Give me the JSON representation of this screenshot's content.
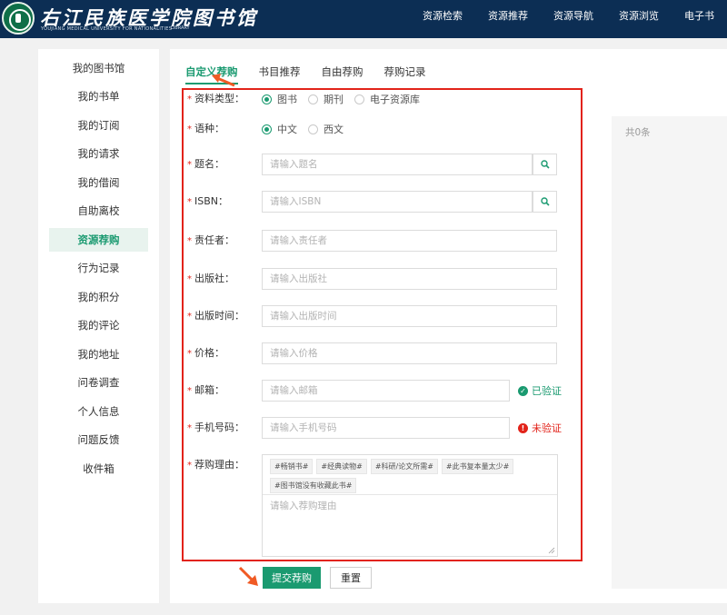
{
  "header": {
    "title": "右江民族医学院图书馆",
    "subtitle": "YOUJIANG MEDICAL UNIVERSITY FOR NATIONALITIES",
    "subtitle2": "LIBRARY",
    "nav": [
      "资源检索",
      "资源推荐",
      "资源导航",
      "资源浏览",
      "电子书"
    ]
  },
  "sidebar": {
    "items": [
      "我的图书馆",
      "我的书单",
      "我的订阅",
      "我的请求",
      "我的借阅",
      "自助离校",
      "资源荐购",
      "行为记录",
      "我的积分",
      "我的评论",
      "我的地址",
      "问卷调查",
      "个人信息",
      "问题反馈",
      "收件箱"
    ],
    "active_index": 6
  },
  "tabs": [
    "自定义荐购",
    "书目推荐",
    "自由荐购",
    "荐购记录"
  ],
  "form": {
    "type": {
      "label": "资料类型：",
      "options": [
        "图书",
        "期刊",
        "电子资源库"
      ],
      "selected": "图书"
    },
    "lang": {
      "label": "语种：",
      "options": [
        "中文",
        "西文"
      ],
      "selected": "中文"
    },
    "title": {
      "label": "题名：",
      "placeholder": "请输入题名"
    },
    "isbn": {
      "label": "ISBN：",
      "placeholder": "请输入ISBN"
    },
    "author": {
      "label": "责任者：",
      "placeholder": "请输入责任者"
    },
    "publisher": {
      "label": "出版社：",
      "placeholder": "请输入出版社"
    },
    "pubdate": {
      "label": "出版时间：",
      "placeholder": "请输入出版时间"
    },
    "price": {
      "label": "价格：",
      "placeholder": "请输入价格"
    },
    "email": {
      "label": "邮箱：",
      "placeholder": "请输入邮箱",
      "status": "已验证"
    },
    "phone": {
      "label": "手机号码：",
      "placeholder": "请输入手机号码",
      "status": "未验证"
    },
    "reason": {
      "label": "荐购理由：",
      "tags": [
        "#畅销书#",
        "#经典读物#",
        "#科研/论文所需#",
        "#此书复本量太少#",
        "#图书馆没有收藏此书#"
      ],
      "placeholder": "请输入荐购理由"
    }
  },
  "buttons": {
    "submit": "提交荐购",
    "reset": "重置"
  },
  "right_panel": {
    "count_text": "共0条"
  },
  "colors": {
    "header_bg": "#0c2e54",
    "accent": "#1a9a70",
    "highlight_red": "#e2231a",
    "arrow": "#f05a24"
  }
}
